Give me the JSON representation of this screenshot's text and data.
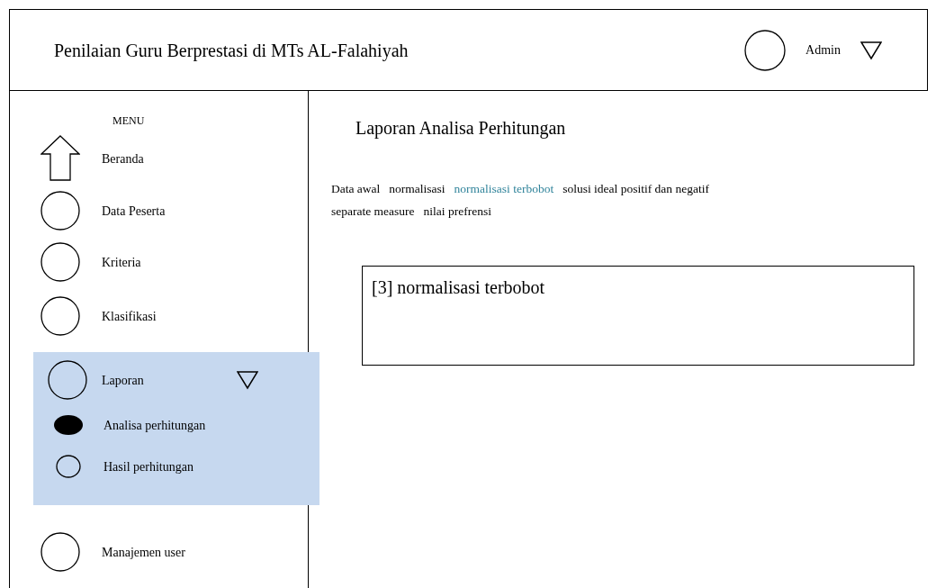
{
  "header": {
    "title": "Penilaian Guru Berprestasi di MTs AL-Falahiyah",
    "user": "Admin"
  },
  "sidebar": {
    "heading": "MENU",
    "items": [
      {
        "label": "Beranda",
        "kind": "home",
        "expanded": false
      },
      {
        "label": "Data Peserta",
        "kind": "circle",
        "expanded": false
      },
      {
        "label": "Kriteria",
        "kind": "circle",
        "expanded": false
      },
      {
        "label": "Klasifikasi",
        "kind": "circle",
        "expanded": false
      },
      {
        "label": "Laporan",
        "kind": "circle",
        "expanded": true,
        "children": [
          {
            "label": "Analisa perhitungan",
            "selected": true
          },
          {
            "label": "Hasil perhitungan",
            "selected": false
          }
        ]
      },
      {
        "label": "Manajemen user",
        "kind": "circle",
        "expanded": false
      }
    ]
  },
  "main": {
    "title": "Laporan Analisa Perhitungan",
    "tabs": [
      {
        "label": "Data awal",
        "selected": false
      },
      {
        "label": "normalisasi",
        "selected": false
      },
      {
        "label": "normalisasi terbobot",
        "selected": true
      },
      {
        "label": "solusi ideal positif dan negatif",
        "selected": false
      },
      {
        "label": "separate measure",
        "selected": false
      },
      {
        "label": "nilai prefrensi",
        "selected": false
      }
    ],
    "panel": {
      "title": "[3] normalisasi terbobot"
    }
  }
}
